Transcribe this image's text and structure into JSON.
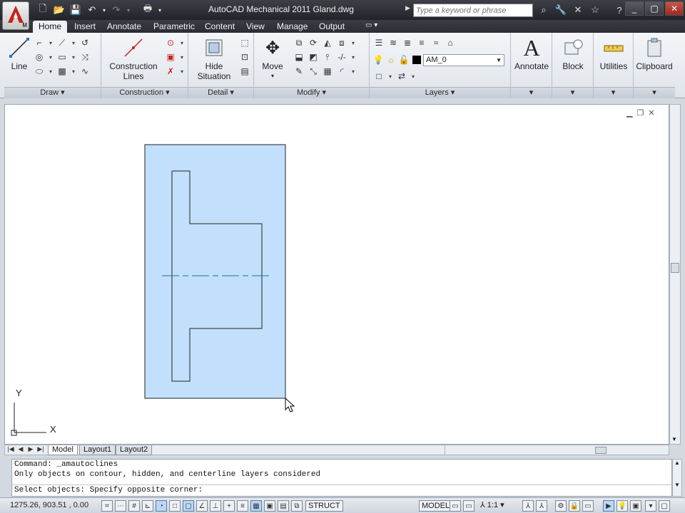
{
  "window": {
    "title": "AutoCAD Mechanical 2011    Gland.dwg",
    "app_badge": "M",
    "search_placeholder": "Type a keyword or phrase"
  },
  "ribbon_tabs": [
    {
      "label": "Home",
      "active": true
    },
    {
      "label": "Insert"
    },
    {
      "label": "Annotate"
    },
    {
      "label": "Parametric"
    },
    {
      "label": "Content"
    },
    {
      "label": "View"
    },
    {
      "label": "Manage"
    },
    {
      "label": "Output"
    }
  ],
  "panels": {
    "draw": {
      "title": "Draw",
      "line_label": "Line"
    },
    "construction": {
      "title": "Construction",
      "construction_lines_label_1": "Construction",
      "construction_lines_label_2": "Lines"
    },
    "detail": {
      "title": "Detail",
      "hide_label_1": "Hide",
      "hide_label_2": "Situation"
    },
    "modify": {
      "title": "Modify",
      "move_label": "Move"
    },
    "layers": {
      "title": "Layers",
      "current_layer": "AM_0"
    },
    "annotate": {
      "label": "Annotate"
    },
    "block": {
      "label": "Block"
    },
    "utilities": {
      "label": "Utilities"
    },
    "clipboard": {
      "label": "Clipboard"
    }
  },
  "ucs": {
    "y_label": "Y",
    "x_label": "X"
  },
  "layout_tabs": [
    {
      "label": "Model",
      "active": true
    },
    {
      "label": "Layout1"
    },
    {
      "label": "Layout2"
    }
  ],
  "command_line": {
    "history": [
      "Command: _amautoclines",
      "Only objects on contour, hidden, and centerline layers considered"
    ],
    "prompt": "Select objects: Specify opposite corner:"
  },
  "status_bar": {
    "coordinates": "1275.26, 903.51 , 0.00",
    "struct_label": "STRUCT",
    "model_label": "MODEL",
    "annotation_scale": "1:1"
  },
  "colors": {
    "selection_fill": "#c2e0fb",
    "centerline": "#1d6f9e"
  }
}
